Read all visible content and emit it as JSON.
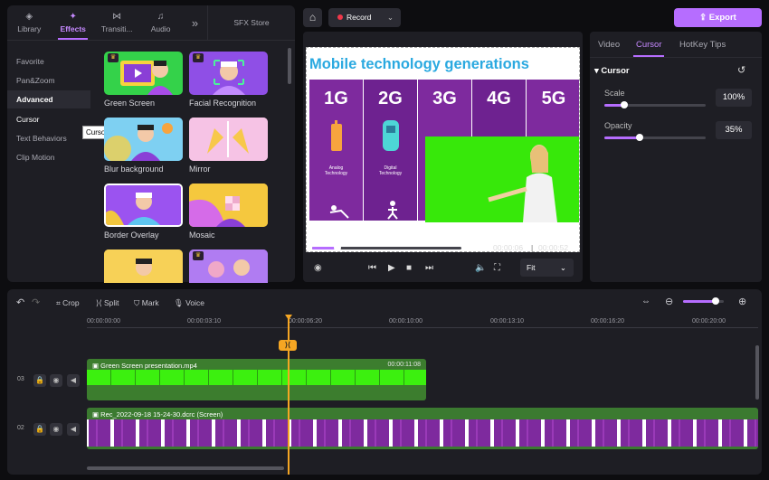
{
  "tabs": [
    {
      "label": "Library",
      "icon": "layers-icon"
    },
    {
      "label": "Effects",
      "icon": "sparkle-icon"
    },
    {
      "label": "Transiti...",
      "icon": "bowtie-icon"
    },
    {
      "label": "Audio",
      "icon": "music-icon"
    },
    {
      "label": "»",
      "icon": "more-icon"
    },
    {
      "label": "SFX Store",
      "icon": ""
    }
  ],
  "categories": [
    "Favorite",
    "Pan&Zoom",
    "Advanced",
    "Cursor",
    "Text Behaviors",
    "Clip Motion"
  ],
  "tooltip": "Cursor",
  "effects": [
    {
      "label": "Green Screen"
    },
    {
      "label": "Facial Recognition"
    },
    {
      "label": "Blur background"
    },
    {
      "label": "Mirror"
    },
    {
      "label": "Border Overlay"
    },
    {
      "label": "Mosaic"
    }
  ],
  "header": {
    "record": "Record",
    "export": "Export"
  },
  "slide": {
    "title": "Mobile technology generations",
    "generations": [
      "1G",
      "2G",
      "3G",
      "4G",
      "5G"
    ],
    "captions": [
      "Analog\nTechnology",
      "Digital\nTechnology"
    ]
  },
  "player": {
    "current": "00:00:06",
    "total": "00:00:52",
    "fit": "Fit"
  },
  "props": {
    "tabs": [
      "Video",
      "Cursor",
      "HotKey Tips"
    ],
    "section": "Cursor",
    "scale_label": "Scale",
    "scale_value": "100%",
    "scale_level": 0.2,
    "opacity_label": "Opacity",
    "opacity_value": "35%",
    "opacity_level": 0.35
  },
  "toolbar": {
    "crop": "Crop",
    "split": "Split",
    "mark": "Mark",
    "voice": "Voice"
  },
  "ruler": [
    "00:00:00:00",
    "00:00:03:10",
    "00:00:06:20",
    "00:00:10:00",
    "00:00:13:10",
    "00:00:16:20",
    "00:00:20:00"
  ],
  "tracks": [
    {
      "num": "03",
      "clip": "Green Screen presentation.mp4",
      "duration": "00:00:11:08"
    },
    {
      "num": "02",
      "clip": "Rec_2022-09-18 15-24-30.dcrc (Screen)",
      "duration": ""
    }
  ],
  "colors": {
    "accent": "#b66dff",
    "green": "#37e80a",
    "playhead": "#f5a623"
  }
}
